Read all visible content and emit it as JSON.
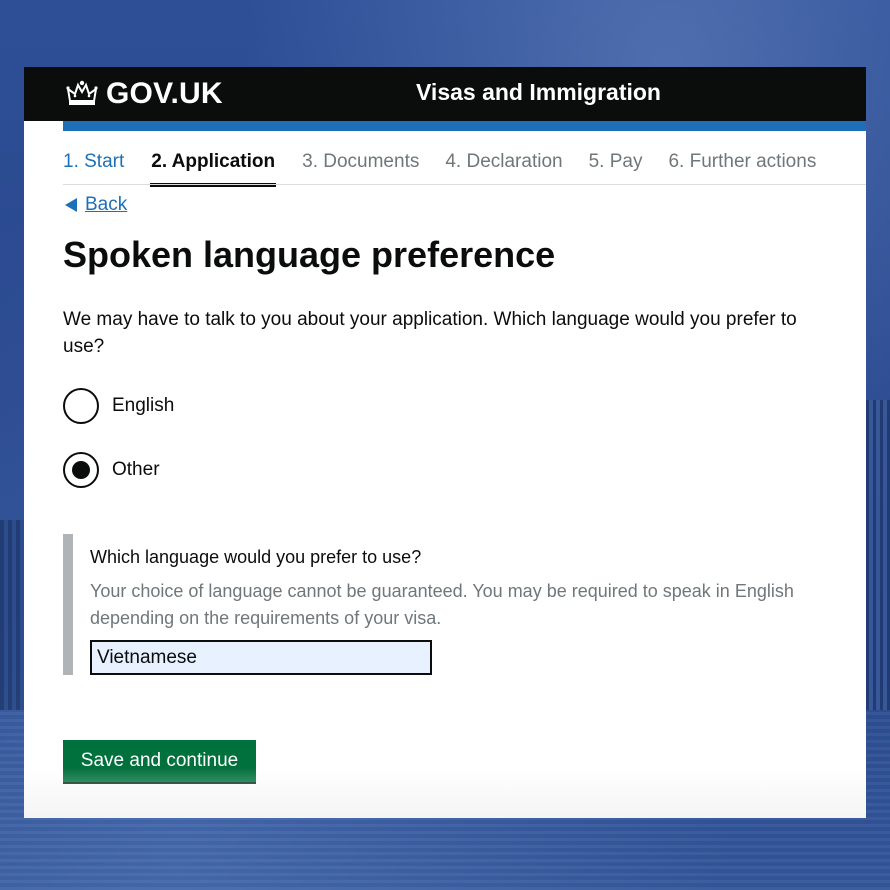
{
  "header": {
    "logo_icon": "crown-icon",
    "logo_text": "GOV.UK",
    "service_name": "Visas and Immigration"
  },
  "steps": [
    {
      "label": "1. Start",
      "state": "done"
    },
    {
      "label": "2. Application",
      "state": "current"
    },
    {
      "label": "3. Documents",
      "state": "upcoming"
    },
    {
      "label": "4. Declaration",
      "state": "upcoming"
    },
    {
      "label": "5. Pay",
      "state": "upcoming"
    },
    {
      "label": "6. Further actions",
      "state": "upcoming"
    }
  ],
  "back": {
    "label": "Back",
    "icon": "back-arrow-icon"
  },
  "page": {
    "title": "Spoken language preference",
    "hint": "We may have to talk to you about your application. Which language would you prefer to use?"
  },
  "options": [
    {
      "label": "English",
      "checked": false
    },
    {
      "label": "Other",
      "checked": true
    }
  ],
  "conditional": {
    "label": "Which language would you prefer to use?",
    "hint": "Your choice of language cannot be guaranteed. You may be required to speak in English depending on the requirements of your visa.",
    "value": "Vietnamese"
  },
  "actions": {
    "save_label": "Save and continue"
  },
  "colors": {
    "header_bg": "#0b0c0c",
    "link": "#1d70b8",
    "button": "#00703c",
    "input_bg": "#e8f1ff"
  }
}
